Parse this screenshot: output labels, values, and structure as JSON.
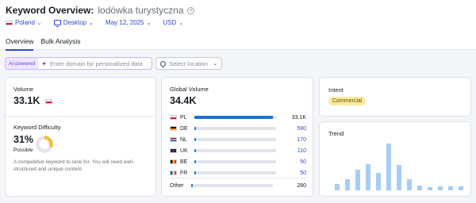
{
  "header": {
    "title": "Keyword Overview:",
    "keyword": "lodówka turystyczna"
  },
  "filters": {
    "country": "Poland",
    "device": "Desktop",
    "date": "May 12, 2025",
    "currency": "USD"
  },
  "tabs": [
    "Overview",
    "Bulk Analysis"
  ],
  "ai": {
    "label": "AI-powered",
    "placeholder": "Enter domain for personalized data",
    "location_placeholder": "Select location"
  },
  "volume": {
    "label": "Volume",
    "value": "33.1K"
  },
  "keyword_difficulty": {
    "label": "Keyword Difficulty",
    "value": "31%",
    "percent": 31,
    "level": "Possible",
    "color": "#f2bd40",
    "description": "A competitive keyword to rank for. You will need well-structured and unique content."
  },
  "global_volume": {
    "label": "Global Volume",
    "value": "34.4K",
    "rows": [
      {
        "code": "PL",
        "value": "33.1K",
        "share": 0.96
      },
      {
        "code": "DE",
        "value": "590",
        "share": 0.02
      },
      {
        "code": "NL",
        "value": "170",
        "share": 0.01
      },
      {
        "code": "UK",
        "value": "110",
        "share": 0.01
      },
      {
        "code": "BE",
        "value": "50",
        "share": 0.005
      },
      {
        "code": "FR",
        "value": "50",
        "share": 0.005
      }
    ],
    "other": {
      "label": "Other",
      "value": "280",
      "share": 0.01
    }
  },
  "intent": {
    "label": "Intent",
    "badge": "Commercial",
    "badge_color": "#fbe9a0"
  },
  "trend": {
    "label": "Trend",
    "values": [
      0.13,
      0.24,
      0.44,
      0.56,
      0.38,
      1.0,
      0.54,
      0.24,
      0.1,
      0.06,
      0.08,
      0.08,
      0.08
    ],
    "color": "#a7cdf4"
  }
}
